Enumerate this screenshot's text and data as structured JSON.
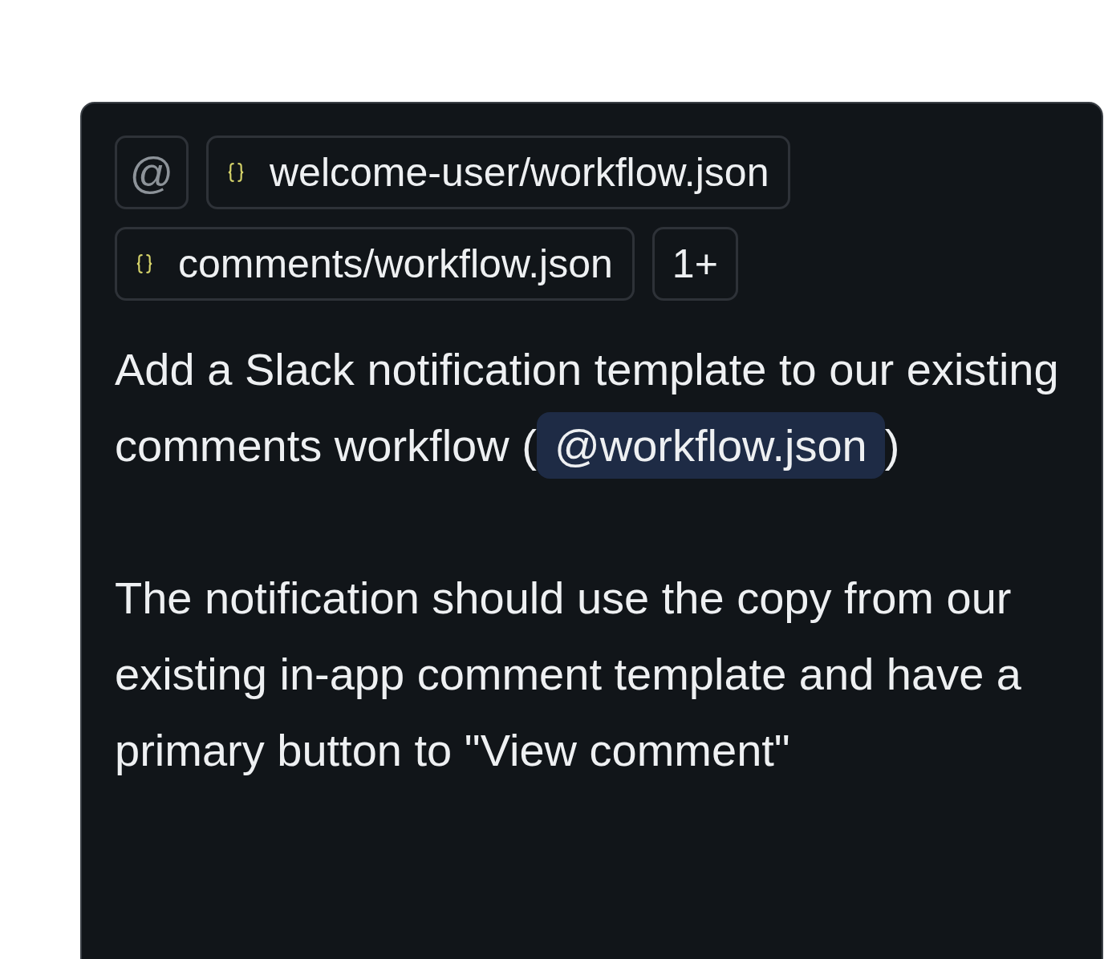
{
  "attachments": {
    "mention_button": "@",
    "files": [
      {
        "name": "welcome-user/workflow.json"
      },
      {
        "name": "comments/workflow.json"
      }
    ],
    "more": "1+"
  },
  "prompt": {
    "paragraphs": [
      [
        {
          "kind": "text",
          "text": "Add a Slack notification template to our existing comments workflow ("
        },
        {
          "kind": "mention",
          "text": "@workflow.json"
        },
        {
          "kind": "text",
          "text": ")"
        }
      ],
      [
        {
          "kind": "text",
          "text": "The notification should use the copy from our existing in-app comment template and have a primary button to \"View comment\""
        }
      ]
    ]
  }
}
